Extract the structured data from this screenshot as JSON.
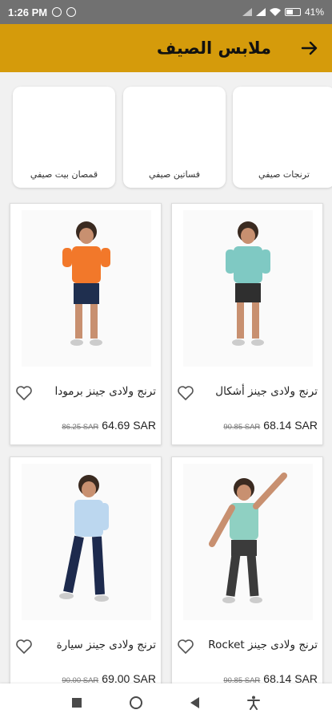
{
  "status_bar": {
    "time": "1:26 PM",
    "battery": "41%"
  },
  "header": {
    "title": "ملابس الصيف",
    "back_icon": "arrow-right-icon"
  },
  "categories": [
    {
      "label": "ترنجات صيفي"
    },
    {
      "label": "فساتين صيفي"
    },
    {
      "label": "قمصان بيت صيفي"
    }
  ],
  "products": [
    {
      "name": "ترنج ولادى جينز أشكال",
      "old_price": "90.85 SAR",
      "price": "68.14 SAR",
      "shirt_color": "#7fc9c3",
      "pants_color": "#2f2f2f"
    },
    {
      "name": "ترنج ولادى جينز برمودا",
      "old_price": "86.25 SAR",
      "price": "64.69 SAR",
      "shirt_color": "#f2782a",
      "pants_color": "#1f2f4f"
    },
    {
      "name": "ترنج ولادى جينز Rocket",
      "old_price": "90.85 SAR",
      "price": "68.14 SAR",
      "shirt_color": "#8fd0c2",
      "pants_color": "#3b3b3b"
    },
    {
      "name": "ترنج ولادى جينز سيارة",
      "old_price": "90.00 SAR",
      "price": "69.00 SAR",
      "shirt_color": "#bcd7ef",
      "pants_color": "#1d2a4d"
    }
  ],
  "colors": {
    "header_bg": "#d59b0b",
    "status_bg": "#717171"
  }
}
